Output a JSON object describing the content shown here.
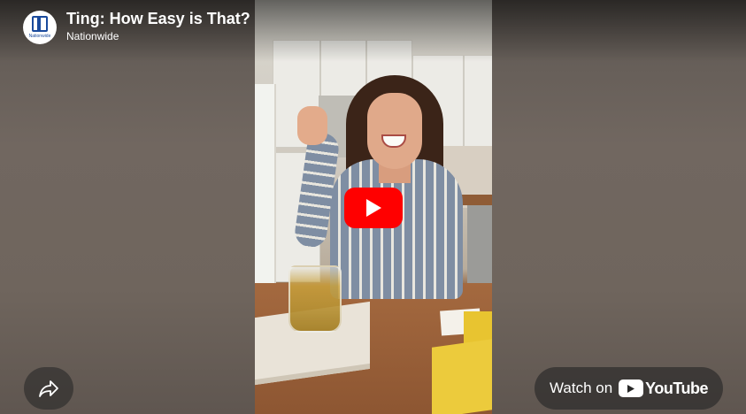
{
  "video": {
    "title": "Ting: How Easy is That?",
    "channel": "Nationwide",
    "avatar_text": "Nationwide"
  },
  "controls": {
    "play_icon": "play-icon",
    "share_icon": "share-arrow-icon",
    "watch_on_label": "Watch on",
    "youtube_wordmark": "YouTube"
  },
  "colors": {
    "play_button": "#ff0000",
    "brand_blue": "#1a4a9c"
  }
}
